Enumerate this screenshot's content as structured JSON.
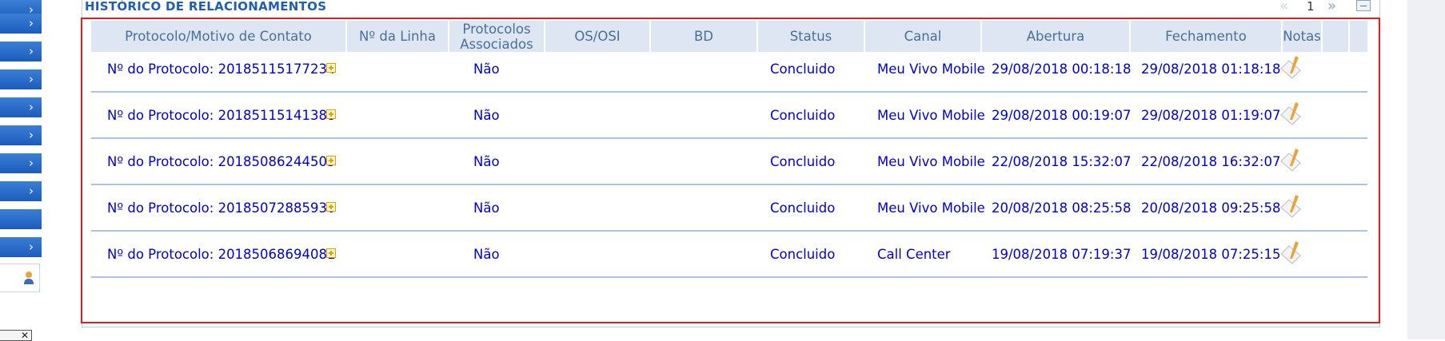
{
  "panel": {
    "title": "HISTÓRICO DE RELACIONAMENTOS",
    "page": "1"
  },
  "table": {
    "headers": [
      "Protocolo/Motivo de Contato",
      "Nº da Linha",
      "Protocolos Associados",
      "OS/OSI",
      "BD",
      "Status",
      "Canal",
      "Abertura",
      "Fechamento",
      "Notas"
    ],
    "rows": [
      {
        "protocolo": "Nº do Protocolo: 20185115177234",
        "linha": "",
        "associados": "Não",
        "os": "",
        "bd": "",
        "status": "Concluido",
        "canal": "Meu Vivo Mobile",
        "abertura": "29/08/2018 00:18:18",
        "fechamento": "29/08/2018 01:18:18"
      },
      {
        "protocolo": "Nº do Protocolo: 20185115141388",
        "linha": "",
        "associados": "Não",
        "os": "",
        "bd": "",
        "status": "Concluido",
        "canal": "Meu Vivo Mobile",
        "abertura": "29/08/2018 00:19:07",
        "fechamento": "29/08/2018 01:19:07"
      },
      {
        "protocolo": "Nº do Protocolo: 20185086244503",
        "linha": "",
        "associados": "Não",
        "os": "",
        "bd": "",
        "status": "Concluido",
        "canal": "Meu Vivo Mobile",
        "abertura": "22/08/2018 15:32:07",
        "fechamento": "22/08/2018 16:32:07"
      },
      {
        "protocolo": "Nº do Protocolo: 20185072885930",
        "linha": "",
        "associados": "Não",
        "os": "",
        "bd": "",
        "status": "Concluido",
        "canal": "Meu Vivo Mobile",
        "abertura": "20/08/2018 08:25:58",
        "fechamento": "20/08/2018 09:25:58"
      },
      {
        "protocolo": "Nº do Protocolo: 20185068694081",
        "linha": "",
        "associados": "Não",
        "os": "",
        "bd": "",
        "status": "Concluido",
        "canal": "Call Center",
        "abertura": "19/08/2018 07:19:37",
        "fechamento": "19/08/2018 07:25:15"
      }
    ]
  },
  "icons": {
    "expand": "plus-square-icon",
    "notes": "pencil-notepad-icon",
    "user": "user-icon",
    "nav": "chevron-right-icon"
  },
  "colors": {
    "accent": "#1f5fae",
    "link": "#0000cc",
    "highlight": "#e01b1b",
    "header_bg": "#dde6f2"
  }
}
